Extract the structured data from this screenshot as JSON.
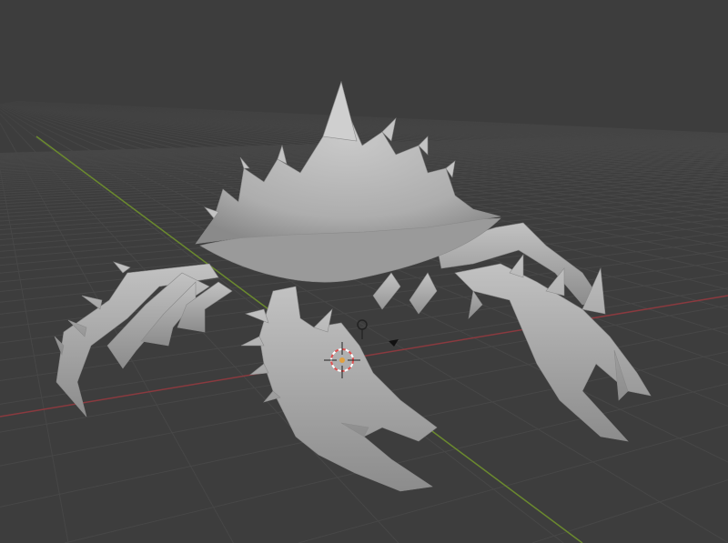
{
  "viewport": {
    "mode": "3D Viewport",
    "colors": {
      "background": "#3d3d3d",
      "grid": "#474747",
      "x_axis": "#8a3a3f",
      "y_axis": "#6b8a2e",
      "mesh": "#b4b4b4",
      "mesh_shadow": "#7e7e7e",
      "cursor_red": "#e05050",
      "cursor_white": "#ffffff"
    },
    "objects": [
      {
        "name": "crab-mesh",
        "icon": "mesh-object"
      },
      {
        "name": "3d-cursor",
        "icon": "crosshair-cursor-icon"
      },
      {
        "name": "light",
        "icon": "light-icon"
      },
      {
        "name": "camera",
        "icon": "camera-icon"
      }
    ]
  }
}
